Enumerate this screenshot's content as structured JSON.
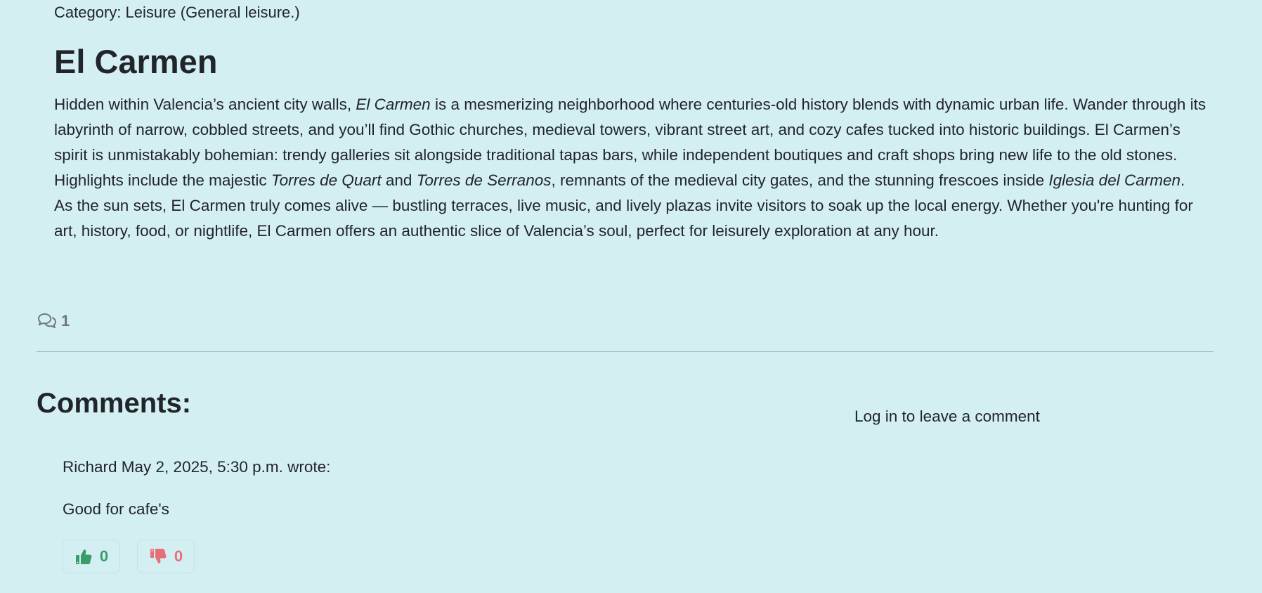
{
  "post": {
    "category": "Category: Leisure (General leisure.)",
    "title": "El Carmen",
    "body": [
      {
        "t": "Hidden within Valencia’s ancient city walls, ",
        "i": false
      },
      {
        "t": "El Carmen",
        "i": true
      },
      {
        "t": " is a mesmerizing neighborhood where centuries-old history blends with dynamic urban life. Wander through its labyrinth of narrow, cobbled streets, and you’ll find Gothic churches, medieval towers, vibrant street art, and cozy cafes tucked into historic buildings. El Carmen’s spirit is unmistakably bohemian: trendy galleries sit alongside traditional tapas bars, while independent boutiques and craft shops bring new life to the old stones. Highlights include the majestic ",
        "i": false
      },
      {
        "t": "Torres de Quart",
        "i": true
      },
      {
        "t": " and ",
        "i": false
      },
      {
        "t": "Torres de Serranos",
        "i": true
      },
      {
        "t": ", remnants of the medieval city gates, and the stunning frescoes inside ",
        "i": false
      },
      {
        "t": "Iglesia del Carmen",
        "i": true
      },
      {
        "t": ". As the sun sets, El Carmen truly comes alive — bustling terraces, live music, and lively plazas invite visitors to soak up the local energy. Whether you're hunting for art, history, food, or nightlife, El Carmen offers an authentic slice of Valencia’s soul, perfect for leisurely exploration at any hour.",
        "i": false
      }
    ],
    "comment_count": "1"
  },
  "comments_section": {
    "heading": "Comments:",
    "login_link": "Log in to leave a comment",
    "comments": [
      {
        "meta": "Richard May 2, 2025, 5:30 p.m. wrote:",
        "text": "Good for cafe's",
        "likes": "0",
        "dislikes": "0"
      }
    ]
  },
  "icons": {
    "comments": "comments-icon",
    "like": "thumbs-up-icon",
    "dislike": "thumbs-down-icon"
  },
  "colors": {
    "background": "#d4eff2",
    "text": "#212529",
    "muted": "#6c757d",
    "like": "#3a9c6b",
    "dislike": "#e5707a"
  }
}
